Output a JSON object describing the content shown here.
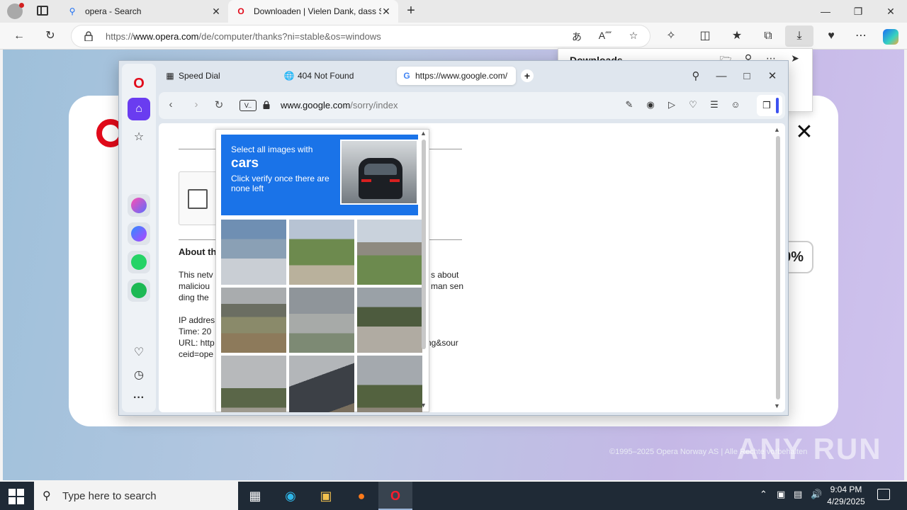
{
  "edge": {
    "tabs": [
      {
        "label": "opera - Search",
        "icon": "search-icon",
        "active": false
      },
      {
        "label": "Downloaden | Vielen Dank, dass Sie",
        "icon": "opera-logo-icon",
        "active": true
      }
    ],
    "url_prefix": "https://",
    "url_host": "www.opera.com",
    "url_path": "/de/computer/thanks?ni=stable&os=windows",
    "downloads_title": "Downloads"
  },
  "opera_page": {
    "percent_badge": "0%",
    "footer": "©1995–2025 Opera Norway AS | Alle Rechte vorbehalten",
    "watermark": "ANY RUN"
  },
  "opera": {
    "tabs": [
      {
        "label": "Speed Dial",
        "icon": "speed-dial-icon"
      },
      {
        "label": "404 Not Found",
        "icon": "globe-icon"
      },
      {
        "label": "https://www.google.com/",
        "icon": "google-icon"
      }
    ],
    "vpn_label": "V..",
    "url_host": "www.google.com",
    "url_path": "/sorry/index"
  },
  "sorry_page": {
    "heading": "About th",
    "para_lines": [
      "This netv",
      "maliciou",
      "ding the"
    ],
    "para_right_lines": [
      "s about",
      "man sen"
    ],
    "info_lines": [
      "IP addres",
      "Time: 20",
      "URL: http",
      "ceid=ope"
    ],
    "url_tail": "ng&sour"
  },
  "captcha": {
    "instruction": "Select all images with",
    "target": "cars",
    "hint": "Click verify once there are none left"
  },
  "taskbar": {
    "search_placeholder": "Type here to search",
    "time": "9:04 PM",
    "date": "4/29/2025"
  },
  "colors": {
    "opera_red": "#e10a1a",
    "opera_purple": "#6a3cf0",
    "captcha_blue": "#1a73e8",
    "taskbar": "#1f2a36"
  }
}
